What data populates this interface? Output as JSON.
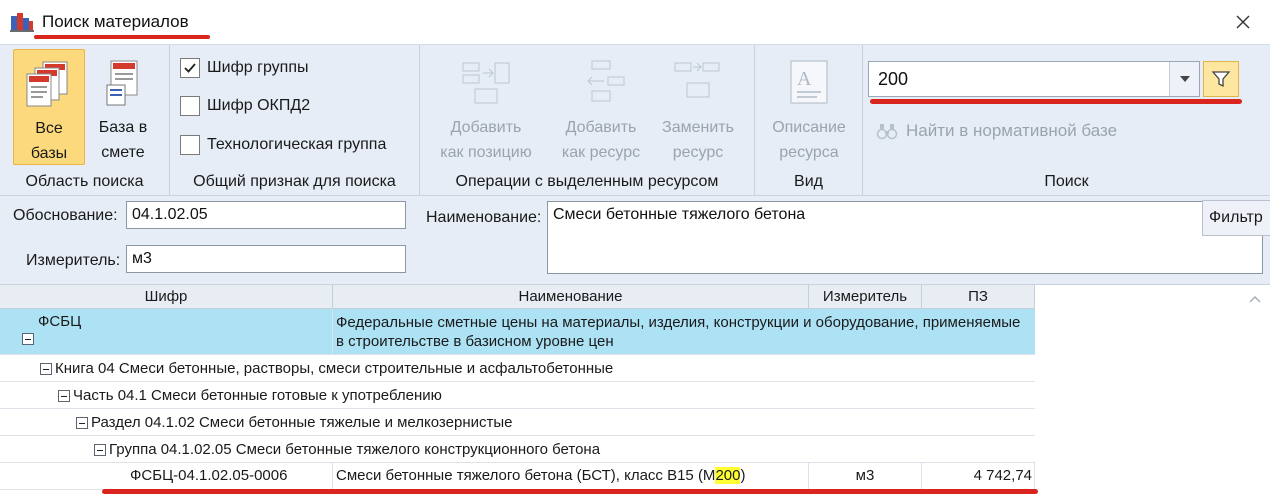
{
  "window": {
    "title": "Поиск материалов"
  },
  "ribbon": {
    "groups": {
      "area": "Область поиска",
      "common": "Общий признак для поиска",
      "ops": "Операции с выделенным ресурсом",
      "view": "Вид",
      "search": "Поиск"
    },
    "all_bases": {
      "line1": "Все",
      "line2": "базы"
    },
    "base_in_estimate": {
      "line1": "База в",
      "line2": "смете"
    },
    "checkboxes": [
      {
        "label": "Шифр группы",
        "checked": true
      },
      {
        "label": "Шифр ОКПД2",
        "checked": false
      },
      {
        "label": "Технологическая группа",
        "checked": false
      }
    ],
    "add_position": {
      "line1": "Добавить",
      "line2": "как позицию"
    },
    "add_resource": {
      "line1": "Добавить",
      "line2": "как ресурс"
    },
    "replace_resource": {
      "line1": "Заменить",
      "line2": "ресурс"
    },
    "describe_resource": {
      "line1": "Описание",
      "line2": "ресурса"
    },
    "search_value": "200",
    "find_in_norm": "Найти в нормативной  базе"
  },
  "tooltip": "Фильтр",
  "form": {
    "basis_label": "Обоснование:",
    "basis_value": "04.1.02.05",
    "unit_label": "Измеритель:",
    "unit_value": "м3",
    "name_label": "Наименование:",
    "name_value": "Смеси бетонные тяжелого бетона"
  },
  "grid": {
    "columns": [
      "Шифр",
      "Наименование",
      "Измеритель",
      "ПЗ"
    ],
    "rows": {
      "fsbc": {
        "code": "ФСБЦ",
        "name": "Федеральные сметные цены на материалы, изделия,  конструкции и оборудование, применяемые в строительстве в базисном уровне цен"
      },
      "book": {
        "text": "Книга 04 Смеси бетонные, растворы, смеси строительные и асфальтобетонные"
      },
      "part": {
        "text": "Часть 04.1 Смеси бетонные готовые к употреблению"
      },
      "section": {
        "text": "Раздел 04.1.02 Смеси бетонные тяжелые и мелкозернистые"
      },
      "group": {
        "text": "Группа 04.1.02.05 Смеси бетонные тяжелого конструкционного бетона"
      },
      "item": {
        "code": "ФСБЦ-04.1.02.05-0006",
        "name_before": "Смеси бетонные тяжелого бетона (БСТ), класс В15 (М",
        "name_highlight": "200",
        "name_after": ")",
        "unit": "м3",
        "price": "4 742,74"
      }
    }
  },
  "colors": {
    "ribbon_bg": "#e6edf6",
    "active_button": "#fcd97c",
    "selected_row": "#ade2f5",
    "highlight": "#ffff33",
    "annotation_red": "#d9251d"
  }
}
